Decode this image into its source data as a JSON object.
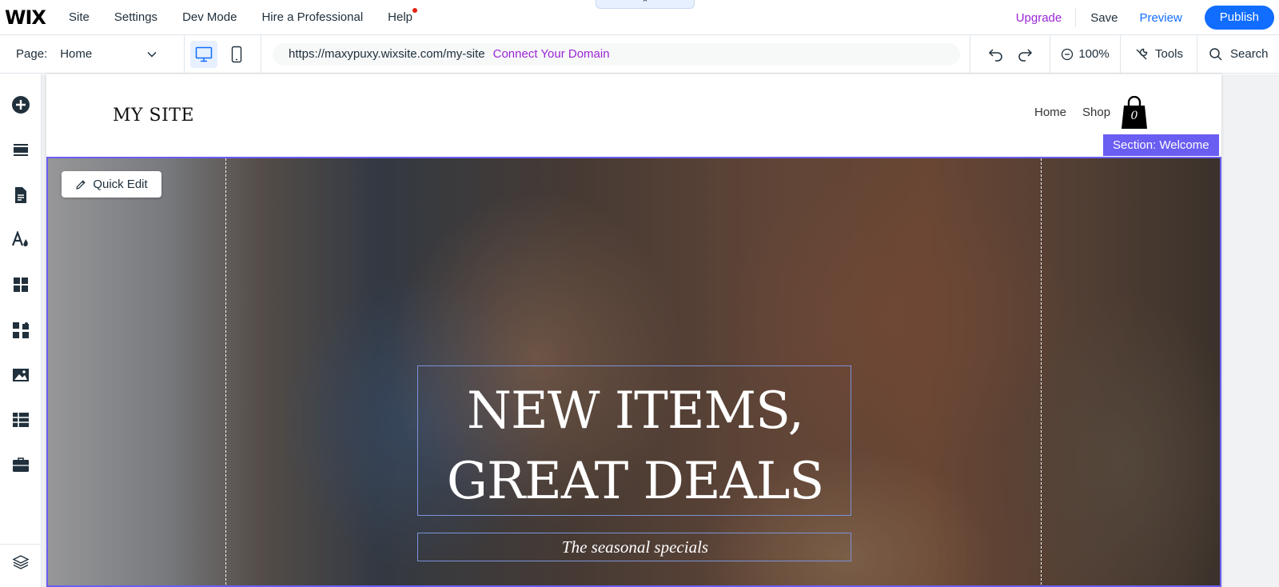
{
  "topbar": {
    "logo": "WIX",
    "menu": [
      "Site",
      "Settings",
      "Dev Mode",
      "Hire a Professional",
      "Help"
    ],
    "collapse_glyph": "⌃",
    "upgrade": "Upgrade",
    "save": "Save",
    "preview": "Preview",
    "publish": "Publish",
    "colors": {
      "accent": "#116dff",
      "upgrade": "#9a27d5",
      "notification": "#e62214"
    }
  },
  "subbar": {
    "page_label": "Page:",
    "page_value": "Home",
    "devices": [
      "desktop-icon",
      "mobile-icon"
    ],
    "url": "https://maxypuxy.wixsite.com/my-site",
    "connect_domain": "Connect Your Domain",
    "zoom": "100%",
    "tools": "Tools",
    "search": "Search"
  },
  "leftbar": {
    "items": [
      "add-elements-icon",
      "add-section-icon",
      "pages-icon",
      "site-design-icon",
      "add-apps-icon",
      "business-tools-icon",
      "media-icon",
      "cms-icon",
      "portfolio-icon",
      "layers-icon"
    ]
  },
  "site": {
    "title": "MY SITE",
    "nav": [
      "Home",
      "Shop"
    ],
    "cart_count": "0",
    "section_tag": "Section: Welcome",
    "section_color": "#6a5df2",
    "quick_edit": "Quick Edit",
    "headline": "NEW ITEMS,\nGREAT DEALS",
    "tagline": "The seasonal specials"
  }
}
